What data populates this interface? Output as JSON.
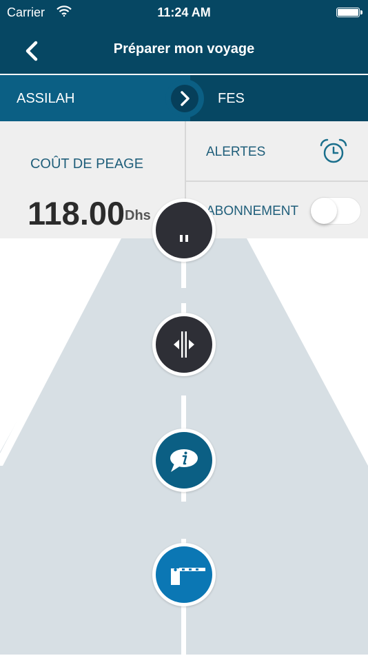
{
  "status_bar": {
    "carrier": "Carrier",
    "time": "11:24 AM"
  },
  "nav": {
    "title": "Préparer mon voyage",
    "back_icon": "chevron-left-icon"
  },
  "route": {
    "from": "ASSILAH",
    "to": "FES",
    "arrow_icon": "chevron-right-icon"
  },
  "cost": {
    "label": "COÛT DE PEAGE",
    "value": "118.00",
    "unit": "Dhs"
  },
  "alerts": {
    "label": "ALERTES",
    "icon": "alarm-clock-icon"
  },
  "subscription": {
    "label": "ABONNEMENT",
    "toggle_on": false
  },
  "road_markers": [
    {
      "name": "top-marker",
      "icon": "pause-icon",
      "color": "#2e2f36"
    },
    {
      "name": "interchange-marker",
      "icon": "interchange-icon",
      "color": "#2e2f36"
    },
    {
      "name": "info-marker",
      "icon": "info-bubble-icon",
      "color": "#0b5f84"
    },
    {
      "name": "toll-barrier-marker",
      "icon": "toll-barrier-icon",
      "color": "#0b77b4"
    }
  ],
  "colors": {
    "header_dark": "#064763",
    "route_from_bg": "#0b5f84",
    "panel_bg": "#efefef",
    "label_blue": "#1f5e7a",
    "road": "#d7dfe4",
    "accent_teal": "#1a6f8c"
  }
}
